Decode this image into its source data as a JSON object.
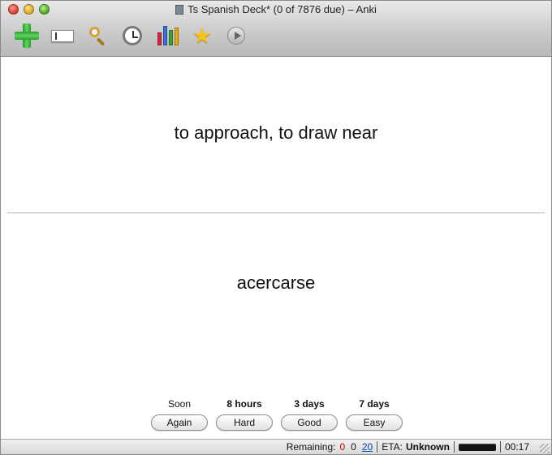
{
  "window": {
    "title": "Ts Spanish Deck* (0 of 7876 due) – Anki"
  },
  "toolbar": {
    "items": [
      {
        "name": "add",
        "icon": "plus-icon"
      },
      {
        "name": "edit",
        "icon": "edit-field-icon"
      },
      {
        "name": "search",
        "icon": "magnifier-icon"
      },
      {
        "name": "timer",
        "icon": "stopwatch-icon"
      },
      {
        "name": "graphs",
        "icon": "bar-graph-icon"
      },
      {
        "name": "mark",
        "icon": "star-icon"
      },
      {
        "name": "play",
        "icon": "play-icon"
      }
    ]
  },
  "card": {
    "question": "to approach, to draw near",
    "answer": "acercarse"
  },
  "answer_buttons": [
    {
      "interval": "Soon",
      "label": "Again"
    },
    {
      "interval": "8 hours",
      "label": "Hard"
    },
    {
      "interval": "3 days",
      "label": "Good"
    },
    {
      "interval": "7 days",
      "label": "Easy"
    }
  ],
  "status": {
    "remaining_label": "Remaining:",
    "count_new": "0",
    "count_review": "0",
    "count_learn": "20",
    "eta_label": "ETA:",
    "eta_value": "Unknown",
    "time": "00:17"
  },
  "colors": {
    "count_new": "#cc0000",
    "count_learn": "#0645ad",
    "graph_bars": [
      "#d7263d",
      "#3a6fd8",
      "#3aa63a",
      "#e6a817",
      "#8e44ad"
    ]
  }
}
